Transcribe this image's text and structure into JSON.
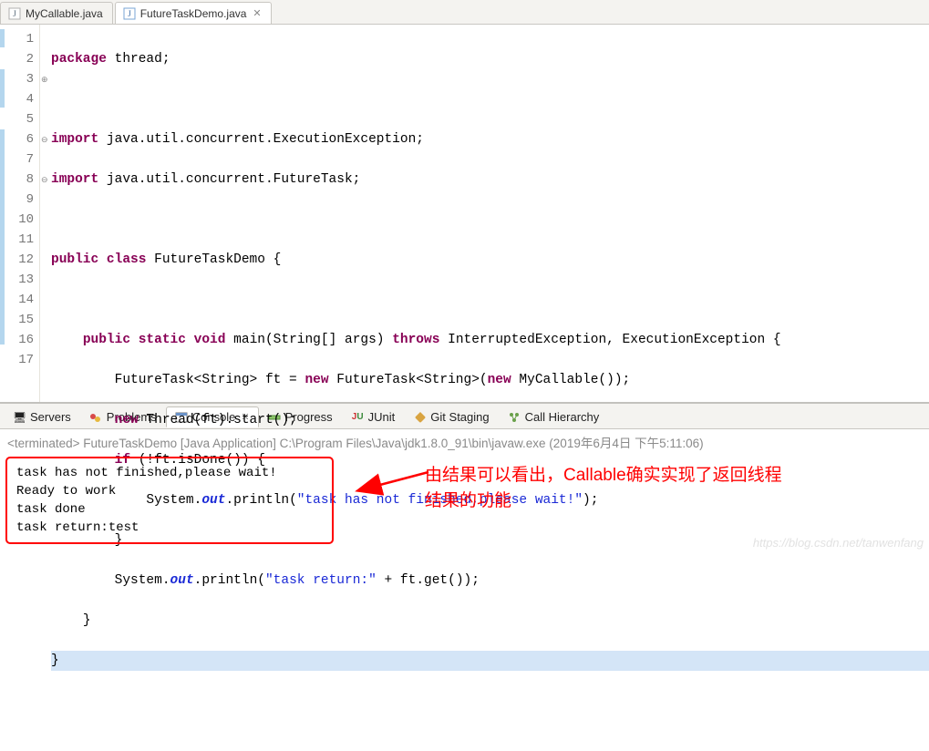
{
  "editorTabs": {
    "tab0": "MyCallable.java",
    "tab1": "FutureTaskDemo.java"
  },
  "gutter": {
    "l1": "1",
    "l2": "2",
    "l3": "3",
    "l4": "4",
    "l5": "5",
    "l6": "6",
    "l7": "7",
    "l8": "8",
    "l9": "9",
    "l10": "10",
    "l11": "11",
    "l12": "12",
    "l13": "13",
    "l14": "14",
    "l15": "15",
    "l16": "16",
    "l17": "17"
  },
  "code": {
    "l1": {
      "kw1": "package",
      "rest": " thread;"
    },
    "l3": {
      "kw1": "import",
      "rest": " java.util.concurrent.ExecutionException;"
    },
    "l4": {
      "kw1": "import",
      "rest": " java.util.concurrent.FutureTask;"
    },
    "l6": {
      "kw1": "public",
      "kw2": "class",
      "name": " FutureTaskDemo ",
      "brace": "{"
    },
    "l8": {
      "indent": "    ",
      "kw1": "public",
      "kw2": "static",
      "kw3": "void",
      "sig": " main(String[] args) ",
      "kw4": "throws",
      "rest": " InterruptedException, ExecutionException {"
    },
    "l9": {
      "indent": "        ",
      "t1": "FutureTask<String> ft = ",
      "kw1": "new",
      "t2": " FutureTask<String>(",
      "kw2": "new",
      "t3": " MyCallable());"
    },
    "l10": {
      "indent": "        ",
      "kw1": "new",
      "t1": " Thread(ft).start();"
    },
    "l11": {
      "indent": "        ",
      "kw1": "if",
      "t1": " (!ft.isDone()) {"
    },
    "l12": {
      "indent": "            ",
      "t1": "System.",
      "out": "out",
      "t2": ".println(",
      "str": "\"task has not finished,please wait!\"",
      "t3": ");"
    },
    "l13": {
      "indent": "        ",
      "brace": "}"
    },
    "l14": {
      "indent": "        ",
      "t1": "System.",
      "out": "out",
      "t2": ".println(",
      "str": "\"task return:\"",
      "t3": " + ft.get());"
    },
    "l15": {
      "indent": "    ",
      "brace": "}"
    },
    "l16": {
      "brace": "}"
    }
  },
  "bottomTabs": {
    "servers": "Servers",
    "problems": "Problems",
    "console": "Console",
    "progress": "Progress",
    "junit": "JUnit",
    "gitstaging": "Git Staging",
    "callhier": "Call Hierarchy"
  },
  "terminated": "<terminated> FutureTaskDemo [Java Application] C:\\Program Files\\Java\\jdk1.8.0_91\\bin\\javaw.exe (2019年6月4日 下午5:11:06)",
  "consoleOut": {
    "l1": "task has not finished,please wait!",
    "l2": "Ready to work",
    "l3": "task done",
    "l4": "task return:test"
  },
  "annotation": {
    "l1": "由结果可以看出，Callable确实实现了返回线程",
    "l2": "结果的功能"
  },
  "watermark": "https://blog.csdn.net/tanwenfang"
}
